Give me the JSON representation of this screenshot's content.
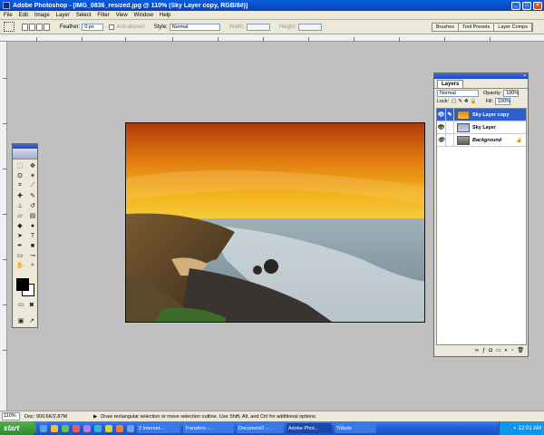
{
  "window": {
    "title": "Adobe Photoshop - [IMG_0836_resized.jpg @ 110% (Sky Layer copy, RGB/8#)]",
    "controls": {
      "minimize": "_",
      "restore": "□",
      "close": "×"
    }
  },
  "menu": {
    "items": [
      "File",
      "Edit",
      "Image",
      "Layer",
      "Select",
      "Filter",
      "View",
      "Window",
      "Help"
    ]
  },
  "options": {
    "feather_label": "Feather:",
    "feather_value": "0 px",
    "antialiased_label": "Anti-aliased",
    "style_label": "Style:",
    "style_value": "Normal",
    "width_label": "Width:",
    "height_label": "Height:",
    "palette_tabs": [
      "Brushes",
      "Tool Presets",
      "Layer Comps"
    ]
  },
  "layers_panel": {
    "tab": "Layers",
    "blend_mode": "Normal",
    "opacity_label": "Opacity:",
    "opacity_value": "100%",
    "lock_label": "Lock:",
    "fill_label": "Fill:",
    "fill_value": "100%",
    "layers": [
      {
        "name": "Sky Layer copy",
        "selected": true
      },
      {
        "name": "Sky Layer",
        "selected": false
      },
      {
        "name": "Background",
        "selected": false
      }
    ]
  },
  "status": {
    "zoom": "110%",
    "doc": "Doc: 900.6K/2.87M",
    "hint": "Draw rectangular selection or move selection outline. Use Shift, Alt, and Ctrl for additional options."
  },
  "taskbar": {
    "start": "start",
    "items": [
      "2 Internet...",
      "Transfers -...",
      "Document2 -...",
      "Adobe Phot...",
      "Tribute"
    ],
    "clock": "12:01 AM"
  },
  "colors": {
    "titlebar": "#0a47cf",
    "selected_layer": "#2f5fc8",
    "taskbar": "#245edc",
    "start": "#3a9a3a"
  }
}
